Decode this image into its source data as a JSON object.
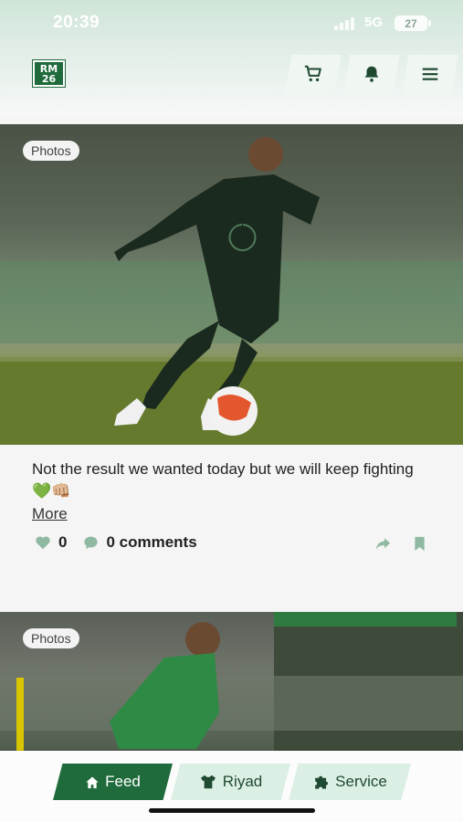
{
  "status_bar": {
    "time": "20:39",
    "network": "5G",
    "battery": "27"
  },
  "header": {
    "logo_text_line1": "RM",
    "logo_text_line2": "26"
  },
  "posts": [
    {
      "badge": "Photos",
      "caption": "Not the result we wanted today but we will keep fighting 💚👊🏼",
      "more_label": "More",
      "likes": "0",
      "comments": "0 comments"
    },
    {
      "badge": "Photos"
    }
  ],
  "bottom_nav": {
    "tabs": [
      {
        "label": "Feed",
        "icon": "home-icon",
        "active": true
      },
      {
        "label": "Riyad",
        "icon": "shirt-icon",
        "active": false
      },
      {
        "label": "Service",
        "icon": "puzzle-icon",
        "active": false
      }
    ]
  },
  "colors": {
    "brand_green": "#1f6b3c",
    "tab_inactive": "#dcefe4",
    "action_icons": "#8fb9a1"
  }
}
